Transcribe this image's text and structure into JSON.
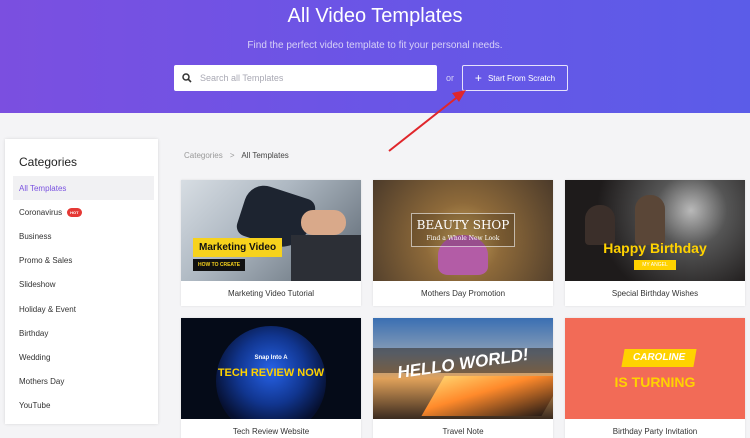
{
  "hero": {
    "title": "All Video Templates",
    "subtitle": "Find the perfect video template to fit your personal needs.",
    "search_placeholder": "Search all Templates",
    "or_text": "or",
    "scratch_label": "Start From Scratch",
    "search_icon": "search-icon",
    "plus_icon": "plus-icon"
  },
  "annotation": {
    "arrow_color": "#e0262b"
  },
  "sidebar": {
    "title": "Categories",
    "items": [
      {
        "label": "All Templates",
        "active": true
      },
      {
        "label": "Coronavirus",
        "badge": "HOT"
      },
      {
        "label": "Business"
      },
      {
        "label": "Promo & Sales"
      },
      {
        "label": "Slideshow"
      },
      {
        "label": "Holiday & Event"
      },
      {
        "label": "Birthday"
      },
      {
        "label": "Wedding"
      },
      {
        "label": "Mothers Day"
      },
      {
        "label": "YouTube"
      }
    ]
  },
  "breadcrumb": {
    "root": "Categories",
    "separator": ">",
    "current": "All Templates"
  },
  "templates": [
    {
      "caption": "Marketing Video Tutorial",
      "thumb_text": [
        "Marketing Video",
        "HOW TO CREATE"
      ]
    },
    {
      "caption": "Mothers Day Promotion",
      "thumb_text": [
        "BEAUTY SHOP",
        "Find a Whole New Look"
      ]
    },
    {
      "caption": "Special Birthday Wishes",
      "thumb_text": [
        "Happy Birthday",
        "MY ANGEL"
      ]
    },
    {
      "caption": "Tech Review Website",
      "thumb_text": [
        "Snap Into A",
        "TECH REVIEW NOW"
      ]
    },
    {
      "caption": "Travel Note",
      "thumb_text": [
        "HELLO WORLD!"
      ]
    },
    {
      "caption": "Birthday Party Invitation",
      "thumb_text": [
        "CAROLINE",
        "IS TURNING"
      ]
    }
  ],
  "colors": {
    "accent": "#7a52e0",
    "hero_start": "#7b4fe0",
    "hero_end": "#5b5ce8",
    "hot_badge": "#e53935"
  }
}
